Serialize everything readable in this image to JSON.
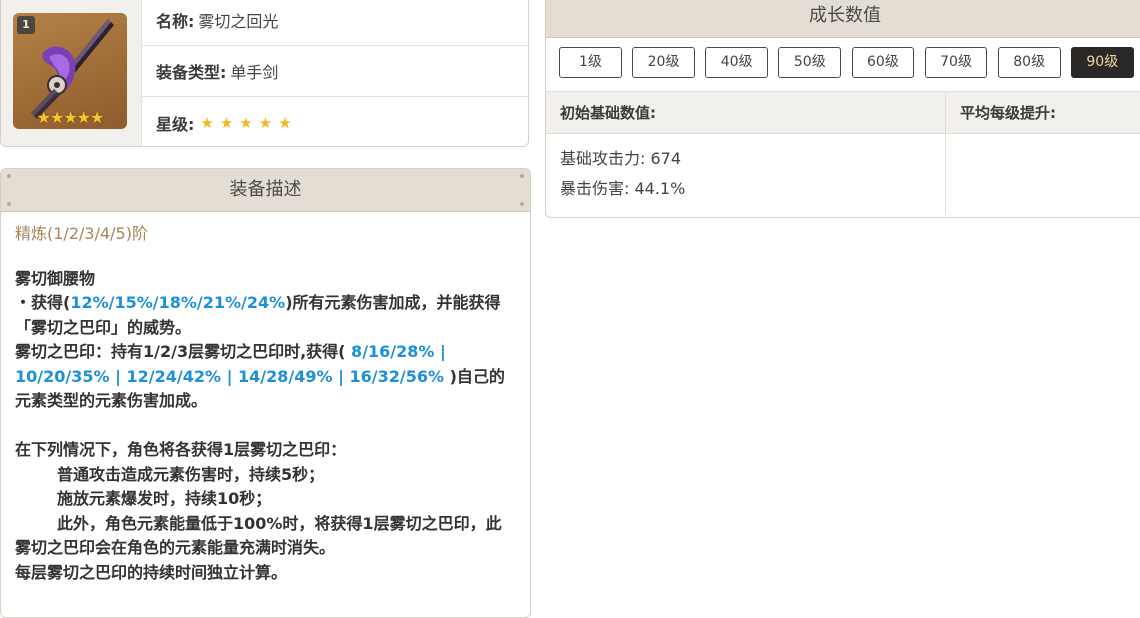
{
  "weapon": {
    "level_badge": "1",
    "thumb_stars": "★★★★★",
    "name_label": "名称:",
    "name_value": "雾切之回光",
    "type_label": "装备类型:",
    "type_value": "单手剑",
    "rarity_label": "星级:",
    "rarity_stars": "★★★★★",
    "rarity": 5
  },
  "description": {
    "header": "装备描述",
    "refine": "精炼(1/2/3/4/5)阶",
    "skill_name": "雾切御腰物",
    "p1_a": "・获得(",
    "p1_hl": "12%/15%/18%/21%/24%",
    "p1_b": ")所有元素伤害加成，并能获得「雾切之巴印」的威势。",
    "p2_a": "雾切之巴印：持有1/2/3层雾切之巴印时,获得(",
    "p2_hl": " 8/16/28% | 10/20/35% | 12/24/42% | 14/28/49% | 16/32/56% ",
    "p2_b": ")自己的元素类型的元素伤害加成。",
    "p3": "在下列情况下，角色将各获得1层雾切之巴印：",
    "item1": "普通攻击造成元素伤害时，持续5秒；",
    "item2": "施放元素爆发时，持续10秒；",
    "item3": "此外，角色元素能量低于100%时，将获得1层雾切之巴印，此雾切之巴印会在角色的元素能量充满时消失。",
    "p4": "每层雾切之巴印的持续时间独立计算。"
  },
  "growth": {
    "header": "成长数值",
    "levels": [
      "1级",
      "20级",
      "40级",
      "50级",
      "60级",
      "70级",
      "80级",
      "90级"
    ],
    "selected_level": "90级",
    "col_base": "初始基础数值:",
    "col_avg": "平均每级提升:",
    "stat_atk": "基础攻击力: 674",
    "stat_crit": "暴击伤害: 44.1%"
  },
  "colors": {
    "highlight": "#1e90d8",
    "refine_text": "#a8845a",
    "header_bg": "#e3ddd3",
    "star": "#f2b81f",
    "active_button_bg": "#2b2927",
    "active_button_text": "#f4d49e"
  }
}
